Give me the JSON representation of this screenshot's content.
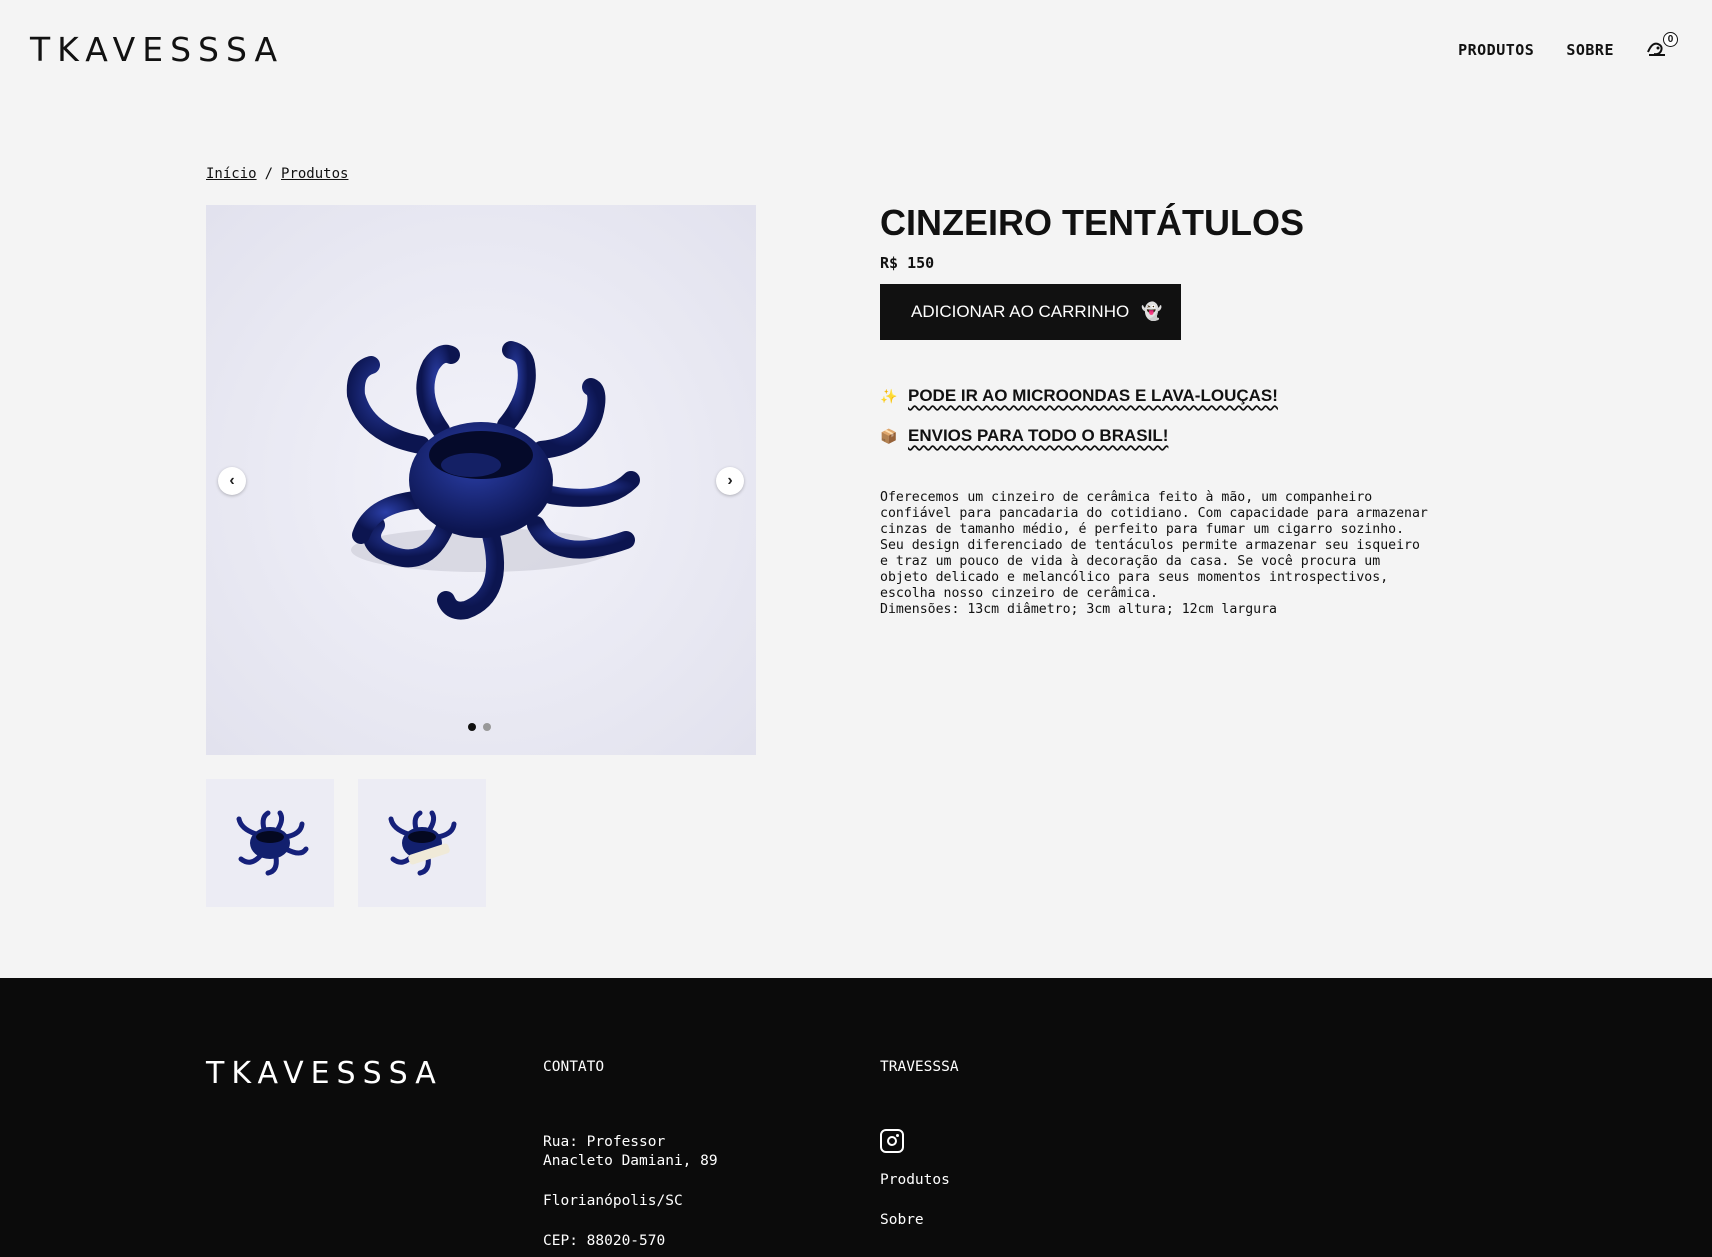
{
  "header": {
    "logo": "TKAVESSSA",
    "nav": [
      {
        "label": "PRODUTOS"
      },
      {
        "label": "SOBRE"
      }
    ],
    "cart_count": "0"
  },
  "breadcrumb": {
    "home": "Início",
    "separator": "/",
    "current": "Produtos"
  },
  "gallery": {
    "dots": 2,
    "active_index": 0,
    "thumbnails": 2
  },
  "product": {
    "title": "CINZEIRO TENTÁTULOS",
    "price": "R$ 150",
    "add_to_cart": "ADICIONAR AO CARRINHO",
    "features": [
      {
        "icon": "sparkle-icon",
        "text": "PODE IR AO MICROONDAS E LAVA-LOUÇAS!"
      },
      {
        "icon": "package-icon",
        "text": "ENVIOS PARA TODO O BRASIL!"
      }
    ],
    "description": "Oferecemos um cinzeiro de cerâmica feito à mão, um companheiro\nconfiável para pancadaria do cotidiano. Com capacidade para armazenar\ncinzas de tamanho médio, é perfeito para fumar um cigarro sozinho.\nSeu design diferenciado de tentáculos permite armazenar seu isqueiro\ne traz um pouco de vida à decoração da casa. Se você procura um\nobjeto delicado e melancólico para seus momentos introspectivos,\nescolha nosso cinzeiro de cerâmica.\nDimensões: 13cm diâmetro; 3cm altura; 12cm largura"
  },
  "footer": {
    "logo": "TKAVESSSA",
    "contact": {
      "heading": "CONTATO",
      "address_line1": "Rua: Professor",
      "address_line2": "Anacleto Damiani, 89",
      "city": "Florianópolis/SC",
      "cep": "CEP: 88020-570"
    },
    "brand": {
      "heading": "TRAVESSSA",
      "links": [
        "Produtos",
        "Sobre"
      ]
    }
  },
  "colors": {
    "background": "#f4f4f4",
    "accent": "#111111",
    "product_blue": "#1a2a7a",
    "footer_bg": "#0b0b0b"
  }
}
